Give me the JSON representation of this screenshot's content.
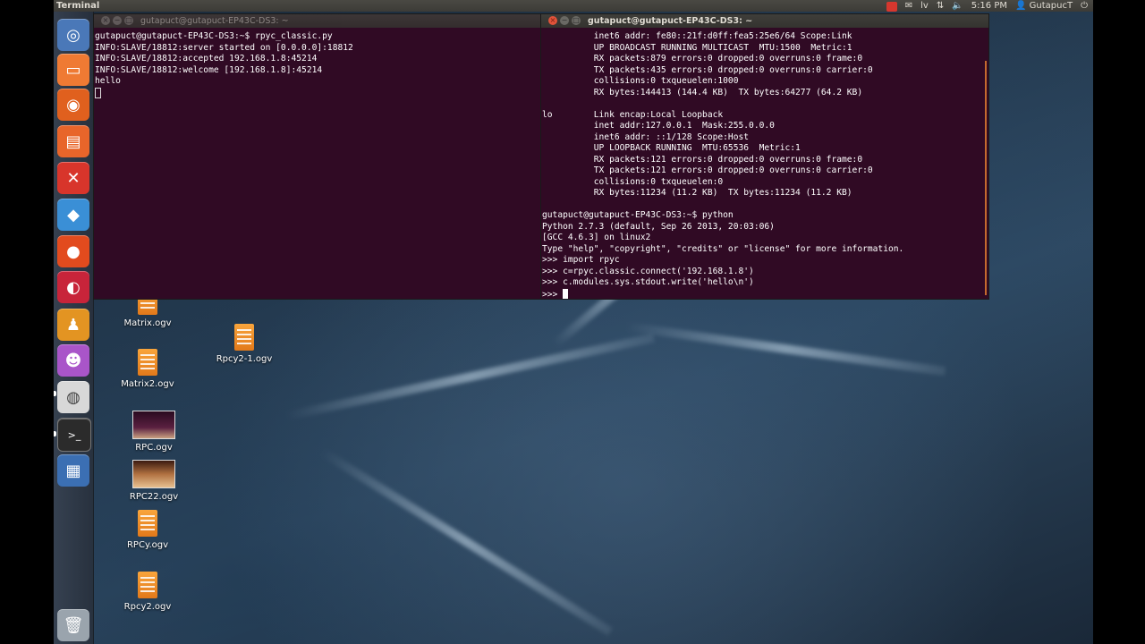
{
  "top_panel": {
    "app_title": "Terminal",
    "keyboard_layout": "lv",
    "clock": "5:16 PM",
    "user": "GutapucT"
  },
  "launcher": {
    "items": [
      {
        "name": "dash-home",
        "icon": "ubuntu-logo-icon",
        "color": "#4a78b8"
      },
      {
        "name": "files",
        "icon": "folder-icon",
        "color": "#ef7a33"
      },
      {
        "name": "firefox",
        "icon": "firefox-icon",
        "color": "#e0601e"
      },
      {
        "name": "software-center",
        "icon": "bag-icon",
        "color": "#e8652a"
      },
      {
        "name": "system-settings",
        "icon": "tools-icon",
        "color": "#d8352b"
      },
      {
        "name": "virtualbox",
        "icon": "cube-icon",
        "color": "#3a8fd6"
      },
      {
        "name": "bomb-app",
        "icon": "bomb-icon",
        "color": "#e24b1e"
      },
      {
        "name": "chromium-red",
        "icon": "swirl-icon",
        "color": "#c8243a"
      },
      {
        "name": "penguin-app",
        "icon": "penguin-icon",
        "color": "#e39422"
      },
      {
        "name": "pidgin",
        "icon": "pidgin-icon",
        "color": "#a955c9"
      },
      {
        "name": "webcam-app",
        "icon": "webcam-icon",
        "color": "#d8d8d8"
      },
      {
        "name": "terminal",
        "icon": "terminal-icon",
        "color": "#2b2b2b"
      },
      {
        "name": "workspaces",
        "icon": "workspace-icon",
        "color": "#3b6fb3"
      },
      {
        "name": "trash",
        "icon": "trash-icon",
        "color": "#9aa4ad"
      }
    ]
  },
  "terminal_left": {
    "title": "gutapuct@gutapuct-EP43C-DS3: ~",
    "lines": [
      "gutapuct@gutapuct-EP43C-DS3:~$ rpyc_classic.py",
      "INFO:SLAVE/18812:server started on [0.0.0.0]:18812",
      "INFO:SLAVE/18812:accepted 192.168.1.8:45214",
      "INFO:SLAVE/18812:welcome [192.168.1.8]:45214",
      "hello"
    ]
  },
  "terminal_right": {
    "title": "gutapuct@gutapuct-EP43C-DS3: ~",
    "lines": [
      "          inet6 addr: fe80::21f:d0ff:fea5:25e6/64 Scope:Link",
      "          UP BROADCAST RUNNING MULTICAST  MTU:1500  Metric:1",
      "          RX packets:879 errors:0 dropped:0 overruns:0 frame:0",
      "          TX packets:435 errors:0 dropped:0 overruns:0 carrier:0",
      "          collisions:0 txqueuelen:1000",
      "          RX bytes:144413 (144.4 KB)  TX bytes:64277 (64.2 KB)",
      "",
      "lo        Link encap:Local Loopback",
      "          inet addr:127.0.0.1  Mask:255.0.0.0",
      "          inet6 addr: ::1/128 Scope:Host",
      "          UP LOOPBACK RUNNING  MTU:65536  Metric:1",
      "          RX packets:121 errors:0 dropped:0 overruns:0 frame:0",
      "          TX packets:121 errors:0 dropped:0 overruns:0 carrier:0",
      "          collisions:0 txqueuelen:0",
      "          RX bytes:11234 (11.2 KB)  TX bytes:11234 (11.2 KB)",
      "",
      "gutapuct@gutapuct-EP43C-DS3:~$ python",
      "Python 2.7.3 (default, Sep 26 2013, 20:03:06)",
      "[GCC 4.6.3] on linux2",
      "Type \"help\", \"copyright\", \"credits\" or \"license\" for more information.",
      ">>> import rpyc",
      ">>> c=rpyc.classic.connect('192.168.1.8')",
      ">>> c.modules.sys.stdout.write('hello\\n')"
    ],
    "prompt": ">>> "
  },
  "desktop_icons": [
    {
      "label": "Matrix.ogv",
      "kind": "ogv"
    },
    {
      "label": "Rpcy2-1.ogv",
      "kind": "ogv"
    },
    {
      "label": "Matrix2.ogv",
      "kind": "ogv"
    },
    {
      "label": "RPC.ogv",
      "kind": "thumb"
    },
    {
      "label": "RPC22.ogv",
      "kind": "thumb"
    },
    {
      "label": "RPCy.ogv",
      "kind": "ogv"
    },
    {
      "label": "Rpcy2.ogv",
      "kind": "ogv"
    }
  ]
}
